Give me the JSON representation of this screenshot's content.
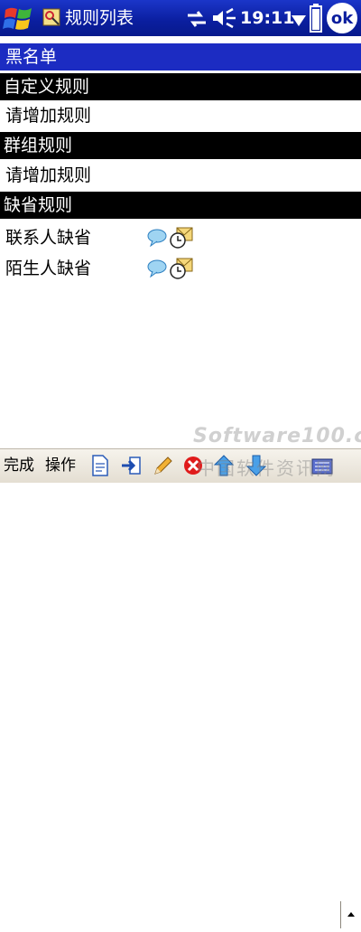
{
  "titlebar": {
    "title": "规则列表",
    "clock": "19:11",
    "ok_label": "ok",
    "colors": {
      "background": "#0a1e9e"
    }
  },
  "content": {
    "header": "黑名单",
    "sections": [
      {
        "title": "自定义规则",
        "rows": [
          {
            "label": "请增加规则"
          }
        ]
      },
      {
        "title": "群组规则",
        "rows": [
          {
            "label": "请增加规则"
          }
        ]
      },
      {
        "title": "缺省规则",
        "rows": [
          {
            "label": "联系人缺省",
            "icons": [
              "chat-bubble-icon",
              "timer-mail-icon"
            ]
          },
          {
            "label": "陌生人缺省",
            "icons": [
              "chat-bubble-icon",
              "timer-mail-icon"
            ]
          }
        ]
      }
    ],
    "colors": {
      "header_band": "#1c2cc2",
      "section_band": "#000000"
    }
  },
  "toolbar": {
    "done_label": "完成",
    "actions_label": "操作",
    "icons": [
      "new-document-icon",
      "import-icon",
      "edit-pencil-icon",
      "delete-icon",
      "move-up-icon",
      "move-down-icon",
      "keyboard-icon",
      "scroll-up-icon"
    ],
    "watermark": "Software100.cn",
    "watermark_cn": "中国软件资讯网"
  }
}
